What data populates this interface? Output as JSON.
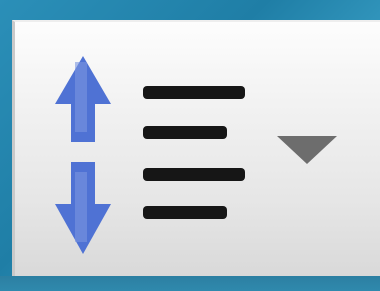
{
  "toolbar": {
    "line_spacing_button": {
      "icon": "line-spacing-icon",
      "dropdown_icon": "dropdown-arrow-icon"
    }
  },
  "colors": {
    "arrow_blue": "#4a6fd0",
    "lines": "#1a1a1a",
    "dropdown": "#6a6a6a",
    "background": "#2b8fb8"
  }
}
